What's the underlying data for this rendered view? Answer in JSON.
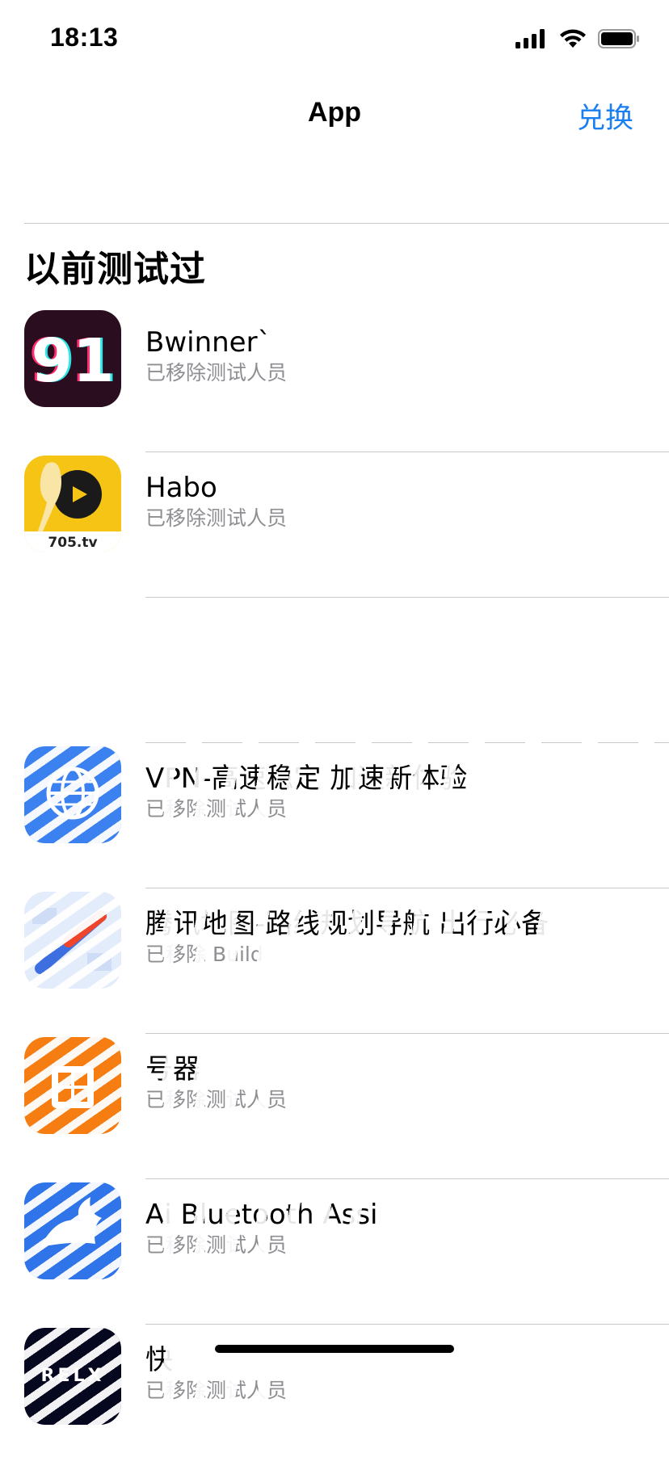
{
  "status_bar": {
    "time": "18:13"
  },
  "nav": {
    "title": "App",
    "action_label": "兑换"
  },
  "section": {
    "title": "以前测试过"
  },
  "apps": [
    {
      "name": "Bwinner`",
      "status": "已移除测试人员",
      "icon": "app-91-icon",
      "icon_text": "91"
    },
    {
      "name": "Habo",
      "status": "已移除测试人员",
      "icon": "app-habo-icon",
      "icon_text": "705.tv"
    },
    {
      "name": "",
      "status": "",
      "icon": "app-blank-icon"
    },
    {
      "name": "VPN-高速稳定 加速新体验",
      "status": "已移除测试人员",
      "icon": "globe-icon"
    },
    {
      "name": "腾讯地图-路线规划导航 出行必备",
      "status": "已移除 Build",
      "icon": "map-icon"
    },
    {
      "name": "号器",
      "status": "已移除测试人员",
      "icon": "calculator-icon"
    },
    {
      "name": "Ai Bluetooth Assi",
      "status": "已移除测试人员",
      "icon": "bluetooth-app-icon"
    },
    {
      "name": "快",
      "status": "已移除测试人员",
      "icon": "relax-app-icon",
      "icon_text": "RELX"
    }
  ],
  "colors": {
    "accent": "#1a7ff0",
    "secondary_text": "#8e8e93",
    "divider": "#c8c8cc"
  }
}
